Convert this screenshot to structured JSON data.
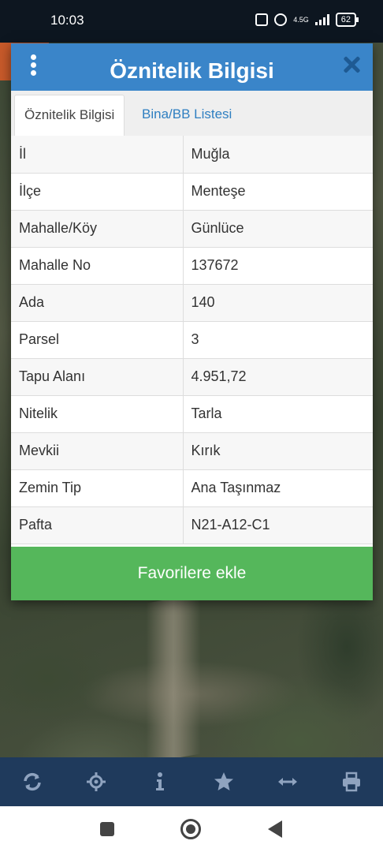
{
  "status_bar": {
    "time": "10:03",
    "network": "4.5G",
    "battery": "62"
  },
  "dialog": {
    "title": "Öznitelik Bilgisi",
    "tabs": [
      {
        "label": "Öznitelik Bilgisi",
        "active": true
      },
      {
        "label": "Bina/BB Listesi",
        "active": false
      }
    ],
    "rows": [
      {
        "key": "İl",
        "value": "Muğla"
      },
      {
        "key": "İlçe",
        "value": "Menteşe"
      },
      {
        "key": "Mahalle/Köy",
        "value": "Günlüce"
      },
      {
        "key": "Mahalle No",
        "value": "137672"
      },
      {
        "key": "Ada",
        "value": "140"
      },
      {
        "key": "Parsel",
        "value": "3"
      },
      {
        "key": "Tapu Alanı",
        "value": "4.951,72"
      },
      {
        "key": "Nitelik",
        "value": "Tarla"
      },
      {
        "key": "Mevkii",
        "value": "Kırık"
      },
      {
        "key": "Zemin Tip",
        "value": "Ana Taşınmaz"
      },
      {
        "key": "Pafta",
        "value": "N21-A12-C1"
      }
    ],
    "favorite_button": "Favorilere ekle"
  },
  "toolbar": {
    "icons": [
      "refresh-icon",
      "locate-icon",
      "info-icon",
      "star-icon",
      "measure-icon",
      "print-icon"
    ]
  },
  "colors": {
    "header": "#3a85c9",
    "favorite": "#55b75b",
    "toolbar": "#1f3a5c",
    "tab_link": "#2f7fc1"
  }
}
